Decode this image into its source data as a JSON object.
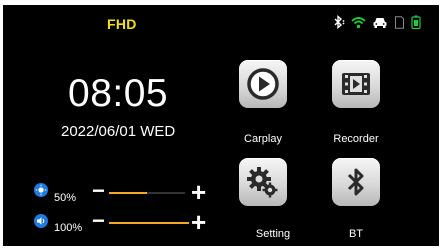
{
  "header": {
    "mode": "FHD"
  },
  "status_icons": [
    "bluetooth-icon",
    "wifi-icon",
    "car-icon",
    "sd-card-icon",
    "battery-icon"
  ],
  "colors": {
    "wifi": "#22c93a",
    "battery": "#22c93a",
    "mode": "#f2e020",
    "slider_fill": "#f5a623",
    "control_icon": "#1f7be0"
  },
  "clock": {
    "time": "08:05",
    "date": "2022/06/01 WED"
  },
  "controls": {
    "brightness": {
      "label": "50%",
      "level": 0.5,
      "minus": "−",
      "plus": "+"
    },
    "volume": {
      "label": "100%",
      "level": 1.0,
      "minus": "−",
      "plus": "+"
    }
  },
  "apps": [
    {
      "label": "Carplay",
      "icon": "carplay-icon"
    },
    {
      "label": "Recorder",
      "icon": "recorder-icon"
    },
    {
      "label": "Setting",
      "icon": "setting-gear-icon"
    },
    {
      "label": "BT",
      "icon": "bluetooth-app-icon"
    }
  ]
}
